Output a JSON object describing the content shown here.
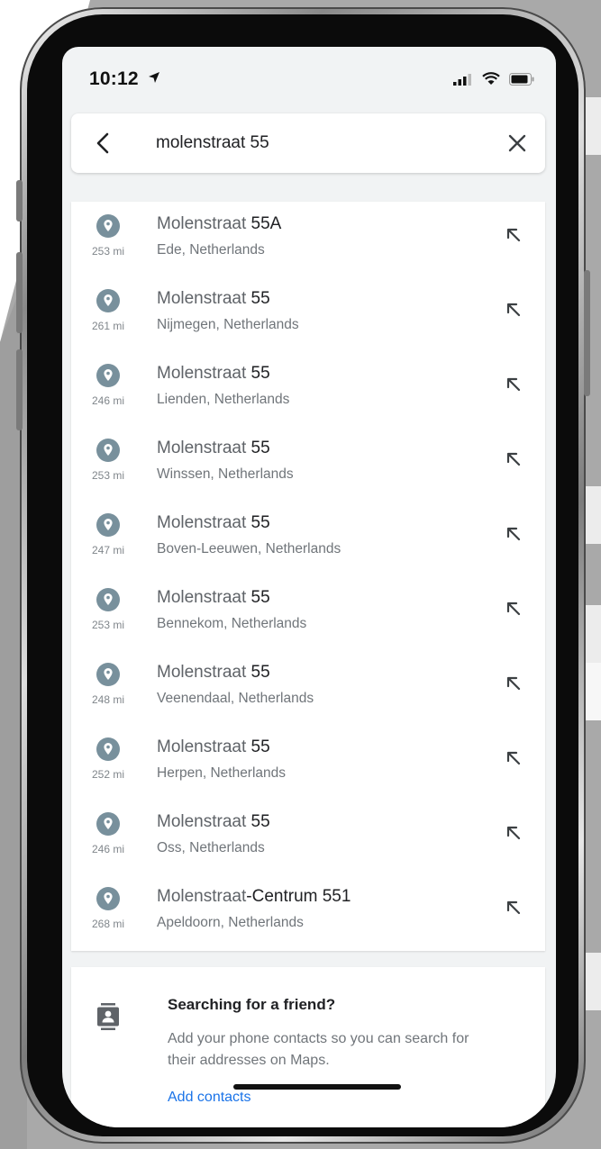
{
  "status_bar": {
    "time": "10:12"
  },
  "search": {
    "query": "molenstraat 55"
  },
  "results": [
    {
      "title_prefix": "Molenstraat ",
      "title_bold": "55A",
      "subtitle": "Ede, Netherlands",
      "distance": "253 mi"
    },
    {
      "title_prefix": "Molenstraat ",
      "title_bold": "55",
      "subtitle": "Nijmegen, Netherlands",
      "distance": "261 mi"
    },
    {
      "title_prefix": "Molenstraat ",
      "title_bold": "55",
      "subtitle": "Lienden, Netherlands",
      "distance": "246 mi"
    },
    {
      "title_prefix": "Molenstraat ",
      "title_bold": "55",
      "subtitle": "Winssen, Netherlands",
      "distance": "253 mi"
    },
    {
      "title_prefix": "Molenstraat ",
      "title_bold": "55",
      "subtitle": "Boven-Leeuwen, Netherlands",
      "distance": "247 mi"
    },
    {
      "title_prefix": "Molenstraat ",
      "title_bold": "55",
      "subtitle": "Bennekom, Netherlands",
      "distance": "253 mi"
    },
    {
      "title_prefix": "Molenstraat ",
      "title_bold": "55",
      "subtitle": "Veenendaal, Netherlands",
      "distance": "248 mi"
    },
    {
      "title_prefix": "Molenstraat ",
      "title_bold": "55",
      "subtitle": "Herpen, Netherlands",
      "distance": "252 mi"
    },
    {
      "title_prefix": "Molenstraat ",
      "title_bold": "55",
      "subtitle": "Oss, Netherlands",
      "distance": "246 mi"
    },
    {
      "title_prefix": "Molenstraat",
      "title_bold": "-Centrum 551",
      "subtitle": "Apeldoorn, Netherlands",
      "distance": "268 mi"
    }
  ],
  "friend_card": {
    "title": "Searching for a friend?",
    "description": "Add your phone contacts so you can search for their addresses on Maps.",
    "action": "Add contacts"
  },
  "icons": {
    "back": "arrow-left-icon",
    "clear": "close-icon",
    "place": "location-pin-icon",
    "fill_query": "arrow-up-left-icon",
    "contacts": "contacts-icon"
  },
  "colors": {
    "pin": "#78909c",
    "link": "#1a73e8",
    "text": "#202124",
    "secondary": "#70757a"
  }
}
